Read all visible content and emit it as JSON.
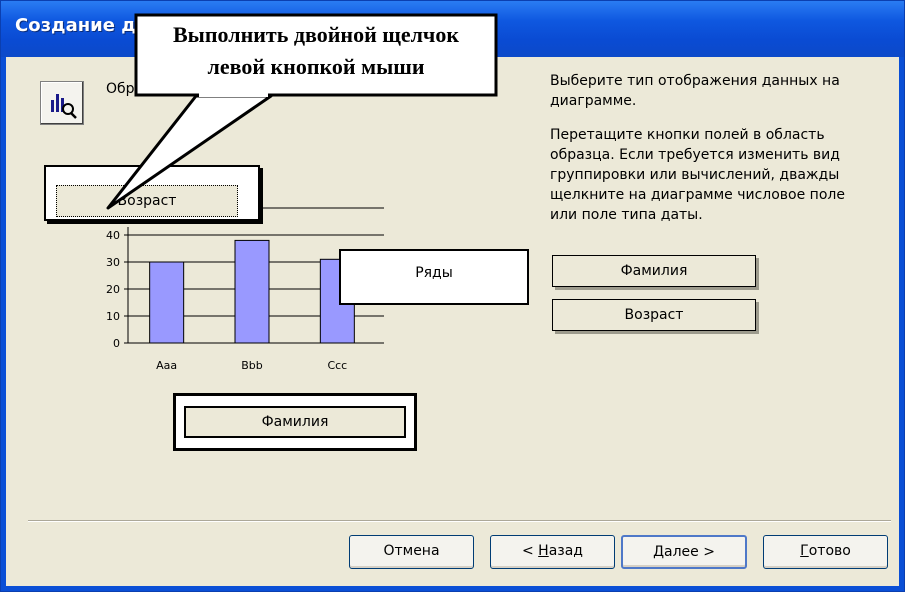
{
  "window": {
    "title": "Создание д"
  },
  "sample": {
    "label": "Образец"
  },
  "callout": {
    "line1": "Выполнить двойной щелчок",
    "line2": "левой кнопкой мыши"
  },
  "drop_zones": {
    "y_field": "Возраст",
    "series": "Ряды",
    "x_field": "Фамилия"
  },
  "instructions": {
    "line1": "Выберите тип отображения данных на",
    "line2": "диаграмме.",
    "para2_line1": "Перетащите кнопки полей в область",
    "para2_line2": "образца. Если требуется изменить вид",
    "para2_line3": "группировки или вычислений, дважды",
    "para2_line4": "щелкните на диаграмме числовое поле",
    "para2_line5": "или поле типа даты."
  },
  "available_fields": [
    "Фамилия",
    "Возраст"
  ],
  "buttons": {
    "cancel": "Отмена",
    "back_prefix": "< ",
    "back_accel": "Н",
    "back_rest": "азад",
    "next_accel": "Д",
    "next_rest": "алее >",
    "finish_accel": "Г",
    "finish_rest": "отово"
  },
  "chart_data": {
    "type": "bar",
    "categories": [
      "Aaa",
      "Bbb",
      "Ccc"
    ],
    "values": [
      30,
      38,
      31
    ],
    "ytick_labels": [
      "0",
      "10",
      "20",
      "30",
      "40"
    ],
    "ylim": [
      0,
      40
    ],
    "grid": true,
    "bar_color": "#9999ff"
  }
}
